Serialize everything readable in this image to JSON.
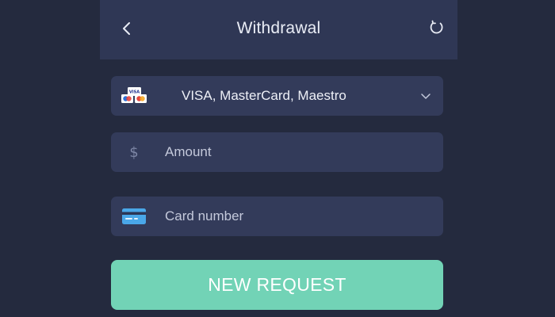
{
  "header": {
    "title": "Withdrawal",
    "back_icon": "chevron-left-icon",
    "refresh_icon": "refresh-icon"
  },
  "payment_method": {
    "selected": "VISA, MasterCard, Maestro",
    "icon": "payment-cards-icon",
    "dropdown_icon": "chevron-down-icon",
    "card_logo_text": "VISA"
  },
  "amount_field": {
    "placeholder": "Amount",
    "value": "",
    "icon_glyph": "$"
  },
  "card_field": {
    "placeholder": "Card number",
    "value": "",
    "icon": "credit-card-icon"
  },
  "submit": {
    "label": "NEW REQUEST"
  },
  "colors": {
    "background": "#242a3e",
    "header": "#2f3755",
    "field": "#333b5a",
    "accent": "#72d3b6"
  }
}
